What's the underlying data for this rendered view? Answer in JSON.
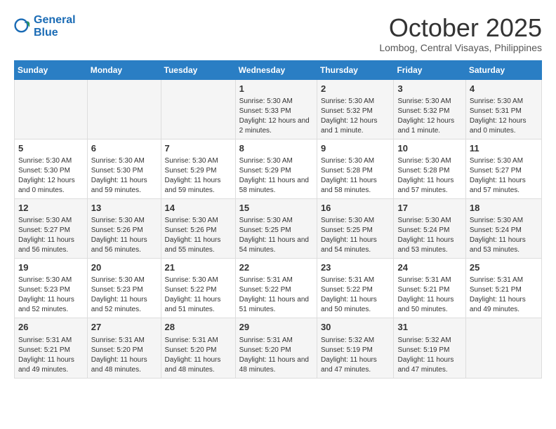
{
  "header": {
    "logo_line1": "General",
    "logo_line2": "Blue",
    "month": "October 2025",
    "location": "Lombog, Central Visayas, Philippines"
  },
  "weekdays": [
    "Sunday",
    "Monday",
    "Tuesday",
    "Wednesday",
    "Thursday",
    "Friday",
    "Saturday"
  ],
  "weeks": [
    [
      {
        "day": "",
        "content": ""
      },
      {
        "day": "",
        "content": ""
      },
      {
        "day": "",
        "content": ""
      },
      {
        "day": "1",
        "content": "Sunrise: 5:30 AM\nSunset: 5:33 PM\nDaylight: 12 hours and 2 minutes."
      },
      {
        "day": "2",
        "content": "Sunrise: 5:30 AM\nSunset: 5:32 PM\nDaylight: 12 hours and 1 minute."
      },
      {
        "day": "3",
        "content": "Sunrise: 5:30 AM\nSunset: 5:32 PM\nDaylight: 12 hours and 1 minute."
      },
      {
        "day": "4",
        "content": "Sunrise: 5:30 AM\nSunset: 5:31 PM\nDaylight: 12 hours and 0 minutes."
      }
    ],
    [
      {
        "day": "5",
        "content": "Sunrise: 5:30 AM\nSunset: 5:30 PM\nDaylight: 12 hours and 0 minutes."
      },
      {
        "day": "6",
        "content": "Sunrise: 5:30 AM\nSunset: 5:30 PM\nDaylight: 11 hours and 59 minutes."
      },
      {
        "day": "7",
        "content": "Sunrise: 5:30 AM\nSunset: 5:29 PM\nDaylight: 11 hours and 59 minutes."
      },
      {
        "day": "8",
        "content": "Sunrise: 5:30 AM\nSunset: 5:29 PM\nDaylight: 11 hours and 58 minutes."
      },
      {
        "day": "9",
        "content": "Sunrise: 5:30 AM\nSunset: 5:28 PM\nDaylight: 11 hours and 58 minutes."
      },
      {
        "day": "10",
        "content": "Sunrise: 5:30 AM\nSunset: 5:28 PM\nDaylight: 11 hours and 57 minutes."
      },
      {
        "day": "11",
        "content": "Sunrise: 5:30 AM\nSunset: 5:27 PM\nDaylight: 11 hours and 57 minutes."
      }
    ],
    [
      {
        "day": "12",
        "content": "Sunrise: 5:30 AM\nSunset: 5:27 PM\nDaylight: 11 hours and 56 minutes."
      },
      {
        "day": "13",
        "content": "Sunrise: 5:30 AM\nSunset: 5:26 PM\nDaylight: 11 hours and 56 minutes."
      },
      {
        "day": "14",
        "content": "Sunrise: 5:30 AM\nSunset: 5:26 PM\nDaylight: 11 hours and 55 minutes."
      },
      {
        "day": "15",
        "content": "Sunrise: 5:30 AM\nSunset: 5:25 PM\nDaylight: 11 hours and 54 minutes."
      },
      {
        "day": "16",
        "content": "Sunrise: 5:30 AM\nSunset: 5:25 PM\nDaylight: 11 hours and 54 minutes."
      },
      {
        "day": "17",
        "content": "Sunrise: 5:30 AM\nSunset: 5:24 PM\nDaylight: 11 hours and 53 minutes."
      },
      {
        "day": "18",
        "content": "Sunrise: 5:30 AM\nSunset: 5:24 PM\nDaylight: 11 hours and 53 minutes."
      }
    ],
    [
      {
        "day": "19",
        "content": "Sunrise: 5:30 AM\nSunset: 5:23 PM\nDaylight: 11 hours and 52 minutes."
      },
      {
        "day": "20",
        "content": "Sunrise: 5:30 AM\nSunset: 5:23 PM\nDaylight: 11 hours and 52 minutes."
      },
      {
        "day": "21",
        "content": "Sunrise: 5:30 AM\nSunset: 5:22 PM\nDaylight: 11 hours and 51 minutes."
      },
      {
        "day": "22",
        "content": "Sunrise: 5:31 AM\nSunset: 5:22 PM\nDaylight: 11 hours and 51 minutes."
      },
      {
        "day": "23",
        "content": "Sunrise: 5:31 AM\nSunset: 5:22 PM\nDaylight: 11 hours and 50 minutes."
      },
      {
        "day": "24",
        "content": "Sunrise: 5:31 AM\nSunset: 5:21 PM\nDaylight: 11 hours and 50 minutes."
      },
      {
        "day": "25",
        "content": "Sunrise: 5:31 AM\nSunset: 5:21 PM\nDaylight: 11 hours and 49 minutes."
      }
    ],
    [
      {
        "day": "26",
        "content": "Sunrise: 5:31 AM\nSunset: 5:21 PM\nDaylight: 11 hours and 49 minutes."
      },
      {
        "day": "27",
        "content": "Sunrise: 5:31 AM\nSunset: 5:20 PM\nDaylight: 11 hours and 48 minutes."
      },
      {
        "day": "28",
        "content": "Sunrise: 5:31 AM\nSunset: 5:20 PM\nDaylight: 11 hours and 48 minutes."
      },
      {
        "day": "29",
        "content": "Sunrise: 5:31 AM\nSunset: 5:20 PM\nDaylight: 11 hours and 48 minutes."
      },
      {
        "day": "30",
        "content": "Sunrise: 5:32 AM\nSunset: 5:19 PM\nDaylight: 11 hours and 47 minutes."
      },
      {
        "day": "31",
        "content": "Sunrise: 5:32 AM\nSunset: 5:19 PM\nDaylight: 11 hours and 47 minutes."
      },
      {
        "day": "",
        "content": ""
      }
    ]
  ]
}
